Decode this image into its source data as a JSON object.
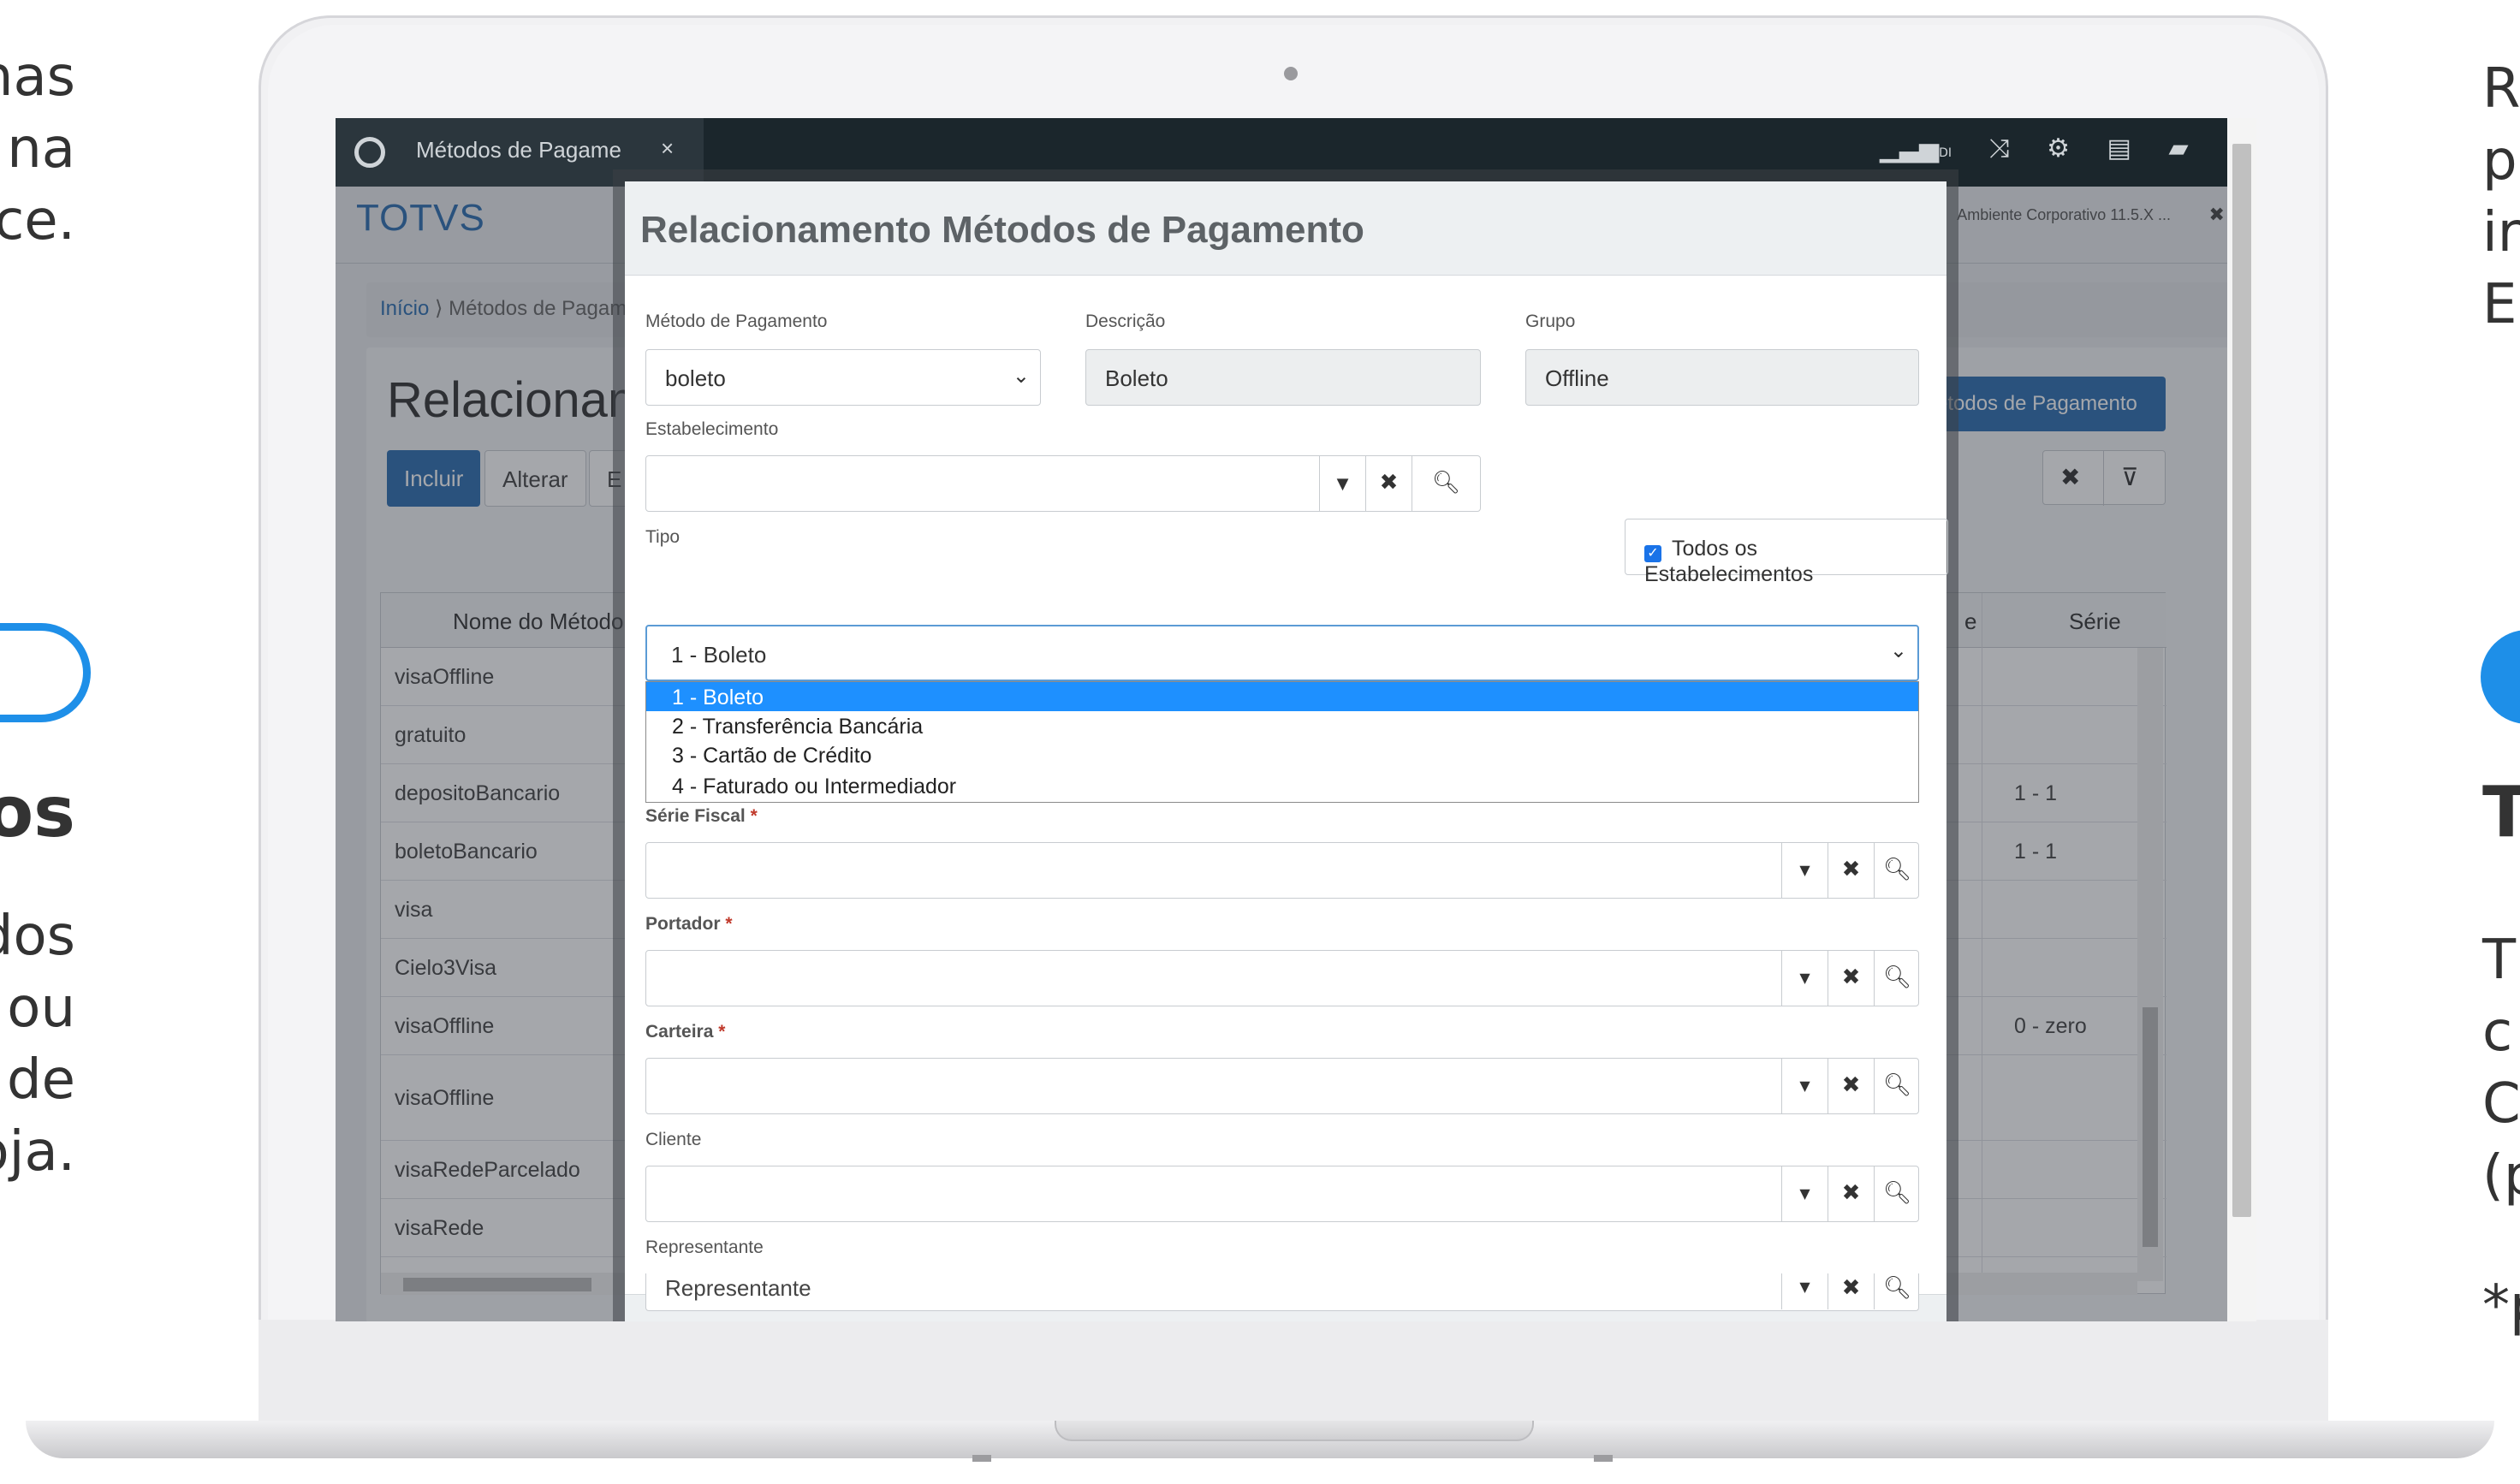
{
  "left_slide_text": {
    "line1": "nas",
    "line2": "na",
    "line3": "ce.",
    "heading": "os",
    "line4": "dos",
    "line5": "ou",
    "line6": "de",
    "line7": "oja."
  },
  "right_slide_text": {
    "line1": "R",
    "line2": "p",
    "line3": "ir",
    "line4": "E",
    "heading": "T",
    "line5": "T",
    "line6": "c",
    "line7": "C",
    "line8": "(p",
    "line9": "*p"
  },
  "browser": {
    "tab_title": "Métodos de Pagament",
    "tab_close": "×",
    "toolbar_icons": [
      "signal-icon",
      "shuffle-icon",
      "gear-icon",
      "document-icon",
      "chat-icon",
      "help-icon"
    ],
    "signal_label": "DI"
  },
  "app": {
    "brand": "TOTVS",
    "environment": "Ambiente Corporativo 11.5.X ...",
    "environment_close": "✖ Sa",
    "breadcrumb_home": "Início",
    "breadcrumb_current": "Métodos de Pagam",
    "page_title": "Relacionam",
    "buttons": {
      "include": "Incluir",
      "alter": "Alterar",
      "other": "E",
      "right_action": "étodos de Pagamento"
    },
    "grid": {
      "col_name": "Nome do Método",
      "col_serie": "Série",
      "col_partial": "e",
      "rows": [
        {
          "name": "visaOffline",
          "serie": ""
        },
        {
          "name": "gratuito",
          "serie": ""
        },
        {
          "name": "depositoBancario",
          "serie": "1 - 1"
        },
        {
          "name": "boletoBancario",
          "serie": "1 - 1"
        },
        {
          "name": "visa",
          "serie": ""
        },
        {
          "name": "Cielo3Visa",
          "serie": ""
        },
        {
          "name": "visaOffline",
          "serie": "0 - zero"
        },
        {
          "name": "visaOffline",
          "serie": ""
        },
        {
          "name": "visaRedeParcelado",
          "serie": ""
        },
        {
          "name": "visaRede",
          "serie": ""
        }
      ]
    }
  },
  "modal": {
    "title": "Relacionamento Métodos de Pagamento",
    "metodo_label": "Método de Pagamento",
    "metodo_value": "boleto",
    "descricao_label": "Descrição",
    "descricao_value": "Boleto",
    "grupo_label": "Grupo",
    "grupo_value": "Offline",
    "estabelecimento_label": "Estabelecimento",
    "estabelecimento_value": "",
    "todos_label": "Todos os Estabelecimentos",
    "todos_checked": true,
    "tipo_label": "Tipo",
    "tipo_value": "1 - Boleto",
    "tipo_options": [
      "1 - Boleto",
      "2 - Transferência Bancária",
      "3 - Cartão de Crédito",
      "4 - Faturado ou Intermediador"
    ],
    "serie_fiscal_label": "Série Fiscal",
    "portador_label": "Portador",
    "carteira_label": "Carteira",
    "cliente_label": "Cliente",
    "representante_label": "Representante",
    "representante_value": "Representante",
    "required_mark": "*"
  },
  "colors": {
    "primary": "#2c6db0",
    "selected_option": "#1e90ff",
    "tabbar": "#1b262c"
  }
}
